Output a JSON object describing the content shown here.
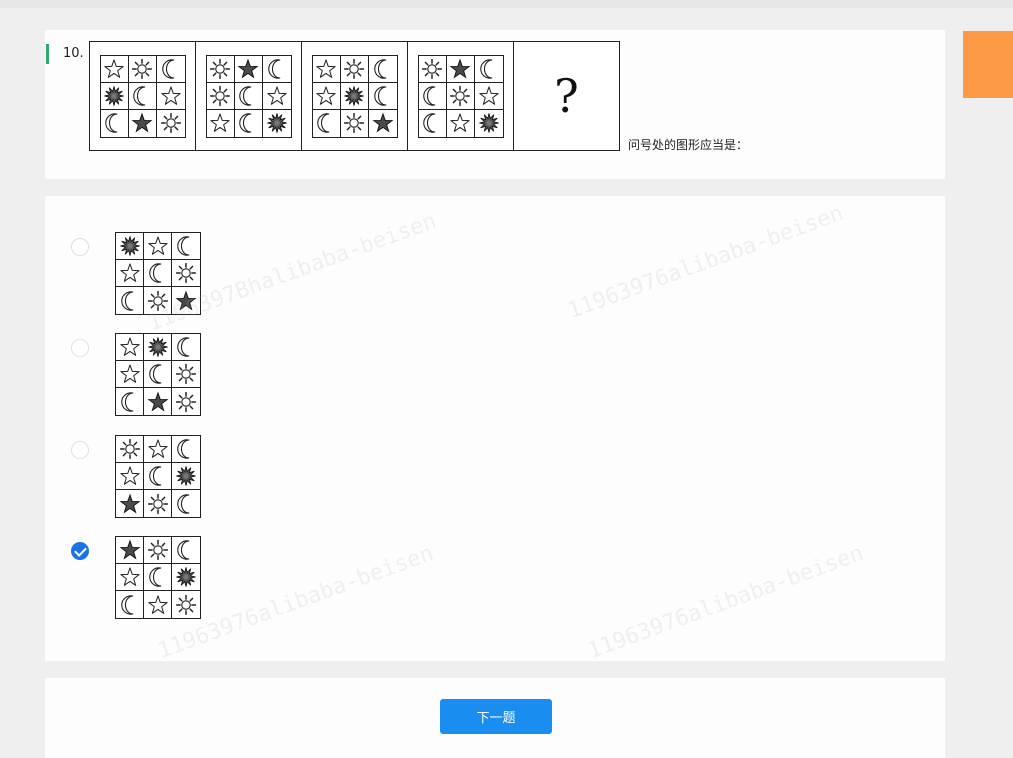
{
  "question": {
    "number": "10.",
    "prompt": "问号处的图形应当是：",
    "question_mark": "?",
    "sequence": [
      [
        [
          "star",
          "sun",
          "moon"
        ],
        [
          "sunburst",
          "moon",
          "star"
        ],
        [
          "moon",
          "starfill",
          "sun"
        ]
      ],
      [
        [
          "sun",
          "starfill",
          "moon"
        ],
        [
          "sun",
          "moon",
          "star"
        ],
        [
          "star",
          "moon",
          "sunburst"
        ]
      ],
      [
        [
          "star",
          "sun",
          "moon"
        ],
        [
          "star",
          "sunburst",
          "moon"
        ],
        [
          "moon",
          "sun",
          "starfill"
        ]
      ],
      [
        [
          "sun",
          "starfill",
          "moon"
        ],
        [
          "moon",
          "sun",
          "star"
        ],
        [
          "moon",
          "star",
          "sunburst"
        ]
      ]
    ]
  },
  "options": [
    {
      "checked": false,
      "grid": [
        [
          "sunburst",
          "star",
          "moon"
        ],
        [
          "star",
          "moon",
          "sun"
        ],
        [
          "moon",
          "sun",
          "starfill"
        ]
      ]
    },
    {
      "checked": false,
      "grid": [
        [
          "star",
          "sunburst",
          "moon"
        ],
        [
          "star",
          "moon",
          "sun"
        ],
        [
          "moon",
          "starfill",
          "sun"
        ]
      ]
    },
    {
      "checked": false,
      "grid": [
        [
          "sun",
          "star",
          "moon"
        ],
        [
          "star",
          "moon",
          "sunburst"
        ],
        [
          "starfill",
          "sun",
          "moon"
        ]
      ]
    },
    {
      "checked": true,
      "grid": [
        [
          "starfill",
          "sun",
          "moon"
        ],
        [
          "star",
          "moon",
          "sunburst"
        ],
        [
          "moon",
          "star",
          "sun"
        ]
      ]
    }
  ],
  "footer": {
    "next_label": "下一题"
  },
  "colors": {
    "accent": "#1a8ef0",
    "marker": "#2faa6c",
    "side_tab": "#fe9a45"
  }
}
